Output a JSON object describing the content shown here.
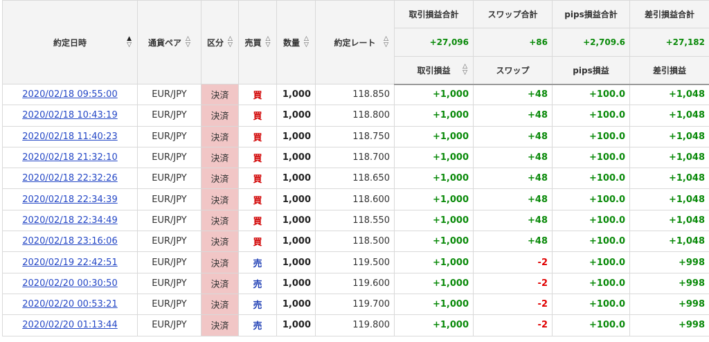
{
  "headers": {
    "date": "約定日時",
    "pair": "通貨ペア",
    "kubun": "区分",
    "baibai": "売買",
    "qty": "数量",
    "rate": "約定レート",
    "pnl_total": "取引損益合計",
    "swap_total": "スワップ合計",
    "pips_total": "pips損益合計",
    "net_total": "差引損益合計",
    "pnl": "取引損益",
    "swap": "スワップ",
    "pips": "pips損益",
    "net": "差引損益"
  },
  "sort_icons": {
    "up_filled": "▲",
    "down_outline": "▽",
    "up_outline": "△"
  },
  "totals": {
    "pnl": "+27,096",
    "swap": "+86",
    "pips": "+2,709.6",
    "net": "+27,182"
  },
  "colors": {
    "positive": "#0a8a0a",
    "negative": "#e00000",
    "buy": "#d10000",
    "sell": "#1f3fb5",
    "kubun_bg": "#f1c6c6",
    "link": "#2447c6"
  },
  "rows": [
    {
      "date": "2020/02/18 09:55:00",
      "pair": "EUR/JPY",
      "kubun": "決済",
      "bs": "買",
      "qty": "1,000",
      "rate": "118.850",
      "pnl": "+1,000",
      "swap": "+48",
      "pips": "+100.0",
      "net": "+1,048"
    },
    {
      "date": "2020/02/18 10:43:19",
      "pair": "EUR/JPY",
      "kubun": "決済",
      "bs": "買",
      "qty": "1,000",
      "rate": "118.800",
      "pnl": "+1,000",
      "swap": "+48",
      "pips": "+100.0",
      "net": "+1,048"
    },
    {
      "date": "2020/02/18 11:40:23",
      "pair": "EUR/JPY",
      "kubun": "決済",
      "bs": "買",
      "qty": "1,000",
      "rate": "118.750",
      "pnl": "+1,000",
      "swap": "+48",
      "pips": "+100.0",
      "net": "+1,048"
    },
    {
      "date": "2020/02/18 21:32:10",
      "pair": "EUR/JPY",
      "kubun": "決済",
      "bs": "買",
      "qty": "1,000",
      "rate": "118.700",
      "pnl": "+1,000",
      "swap": "+48",
      "pips": "+100.0",
      "net": "+1,048"
    },
    {
      "date": "2020/02/18 22:32:26",
      "pair": "EUR/JPY",
      "kubun": "決済",
      "bs": "買",
      "qty": "1,000",
      "rate": "118.650",
      "pnl": "+1,000",
      "swap": "+48",
      "pips": "+100.0",
      "net": "+1,048"
    },
    {
      "date": "2020/02/18 22:34:39",
      "pair": "EUR/JPY",
      "kubun": "決済",
      "bs": "買",
      "qty": "1,000",
      "rate": "118.600",
      "pnl": "+1,000",
      "swap": "+48",
      "pips": "+100.0",
      "net": "+1,048"
    },
    {
      "date": "2020/02/18 22:34:49",
      "pair": "EUR/JPY",
      "kubun": "決済",
      "bs": "買",
      "qty": "1,000",
      "rate": "118.550",
      "pnl": "+1,000",
      "swap": "+48",
      "pips": "+100.0",
      "net": "+1,048"
    },
    {
      "date": "2020/02/18 23:16:06",
      "pair": "EUR/JPY",
      "kubun": "決済",
      "bs": "買",
      "qty": "1,000",
      "rate": "118.500",
      "pnl": "+1,000",
      "swap": "+48",
      "pips": "+100.0",
      "net": "+1,048"
    },
    {
      "date": "2020/02/19 22:42:51",
      "pair": "EUR/JPY",
      "kubun": "決済",
      "bs": "売",
      "qty": "1,000",
      "rate": "119.500",
      "pnl": "+1,000",
      "swap": "-2",
      "pips": "+100.0",
      "net": "+998"
    },
    {
      "date": "2020/02/20 00:30:50",
      "pair": "EUR/JPY",
      "kubun": "決済",
      "bs": "売",
      "qty": "1,000",
      "rate": "119.600",
      "pnl": "+1,000",
      "swap": "-2",
      "pips": "+100.0",
      "net": "+998"
    },
    {
      "date": "2020/02/20 00:53:21",
      "pair": "EUR/JPY",
      "kubun": "決済",
      "bs": "売",
      "qty": "1,000",
      "rate": "119.700",
      "pnl": "+1,000",
      "swap": "-2",
      "pips": "+100.0",
      "net": "+998"
    },
    {
      "date": "2020/02/20 01:13:44",
      "pair": "EUR/JPY",
      "kubun": "決済",
      "bs": "売",
      "qty": "1,000",
      "rate": "119.800",
      "pnl": "+1,000",
      "swap": "-2",
      "pips": "+100.0",
      "net": "+998"
    }
  ]
}
